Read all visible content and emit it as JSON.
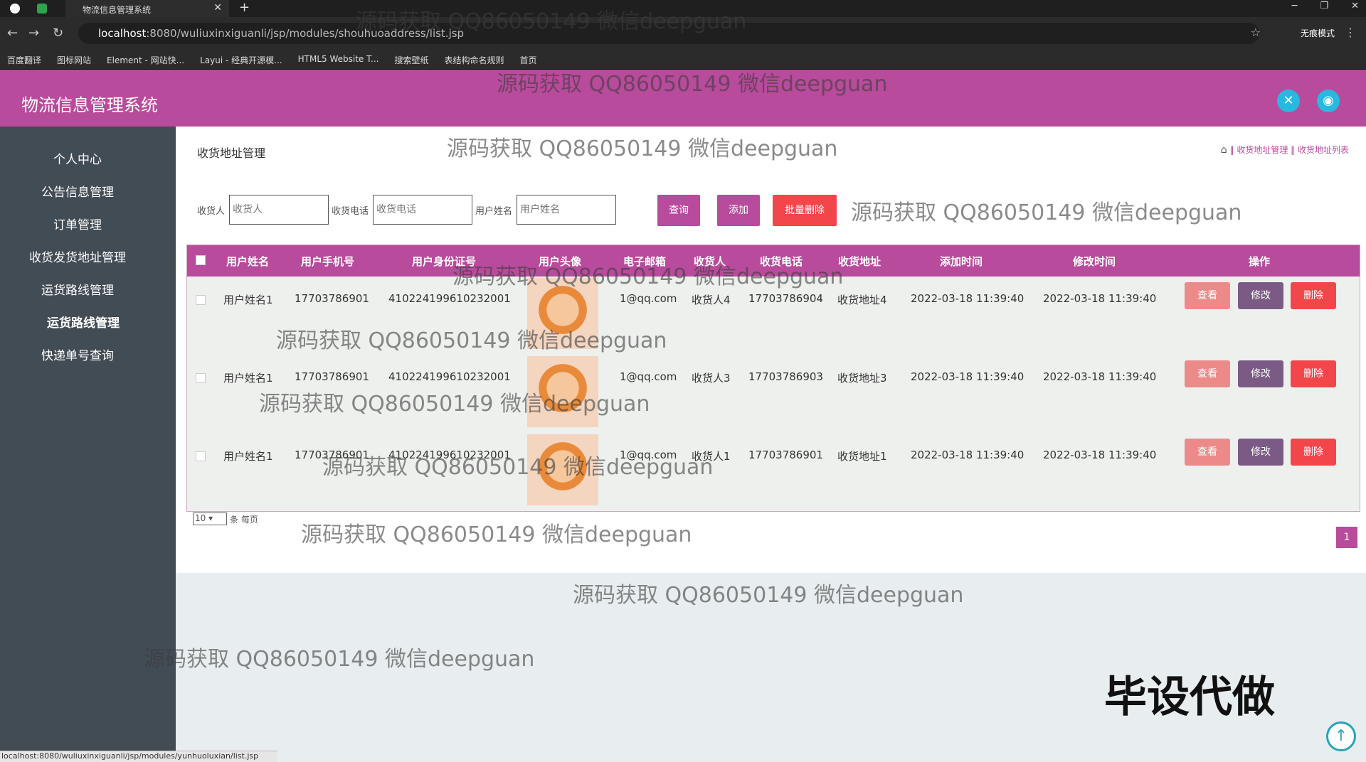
{
  "browser": {
    "tab_title": "物流信息管理系统",
    "url_host": "localhost",
    "url_rest": ":8080/wuliuxinxiguanli/jsp/modules/shouhuoaddress/list.jsp",
    "incognito_label": "无痕模式",
    "bookmarks": [
      "百度翻译",
      "图标网站",
      "Element - 网站快...",
      "Layui - 经典开源模...",
      "HTML5 Website T...",
      "搜索壁纸",
      "表结构命名规则",
      "首页"
    ],
    "status_url": "localhost:8080/wuliuxinxiguanli/jsp/modules/yunhuoluxian/list.jsp"
  },
  "header": {
    "title": "物流信息管理系统"
  },
  "sidebar": {
    "items": [
      {
        "label": "个人中心"
      },
      {
        "label": "公告信息管理"
      },
      {
        "label": "订单管理"
      },
      {
        "label": "收货发货地址管理"
      },
      {
        "label": "运货路线管理"
      },
      {
        "label": "运货路线管理"
      },
      {
        "label": "快递单号查询"
      }
    ]
  },
  "page": {
    "title": "收货地址管理",
    "breadcrumb": [
      "收货地址管理",
      "收货地址列表"
    ]
  },
  "search": {
    "fields": [
      {
        "label": "收货人",
        "placeholder": "收货人"
      },
      {
        "label": "收货电话",
        "placeholder": "收货电话"
      },
      {
        "label": "用户姓名",
        "placeholder": "用户姓名"
      }
    ],
    "query_label": "查询",
    "add_label": "添加",
    "batch_delete_label": "批量删除"
  },
  "table": {
    "columns": [
      "用户姓名",
      "用户手机号",
      "用户身份证号",
      "用户头像",
      "电子邮箱",
      "收货人",
      "收货电话",
      "收货地址",
      "添加时间",
      "修改时间",
      "操作"
    ],
    "rows": [
      {
        "name": "用户姓名1",
        "phone": "17703786901",
        "id_card": "410224199610232001",
        "email": "1@qq.com",
        "receiver": "收货人4",
        "receiver_phone": "17703786904",
        "address": "收货地址4",
        "created": "2022-03-18 11:39:40",
        "updated": "2022-03-18 11:39:40"
      },
      {
        "name": "用户姓名1",
        "phone": "17703786901",
        "id_card": "410224199610232001",
        "email": "1@qq.com",
        "receiver": "收货人3",
        "receiver_phone": "17703786903",
        "address": "收货地址3",
        "created": "2022-03-18 11:39:40",
        "updated": "2022-03-18 11:39:40"
      },
      {
        "name": "用户姓名1",
        "phone": "17703786901",
        "id_card": "410224199610232001",
        "email": "1@qq.com",
        "receiver": "收货人1",
        "receiver_phone": "17703786901",
        "address": "收货地址1",
        "created": "2022-03-18 11:39:40",
        "updated": "2022-03-18 11:39:40"
      }
    ],
    "actions": {
      "view": "查看",
      "edit": "修改",
      "delete": "删除"
    }
  },
  "pagination": {
    "page_size": "10",
    "page_size_suffix": "条 每页",
    "current_page": "1"
  },
  "watermark": "源码获取 QQ86050149 微信deepguan",
  "promo_text": "毕设代做",
  "colors": {
    "primary": "#b84b9c",
    "sidebar": "#424c55",
    "view_btn": "#ec8a8a",
    "edit_btn": "#7b5b85",
    "delete_btn": "#f2464a",
    "header_icon": "#27b9df"
  },
  "icons": [
    "fullscreen-icon",
    "user-icon",
    "home-icon",
    "back-to-top-icon"
  ]
}
